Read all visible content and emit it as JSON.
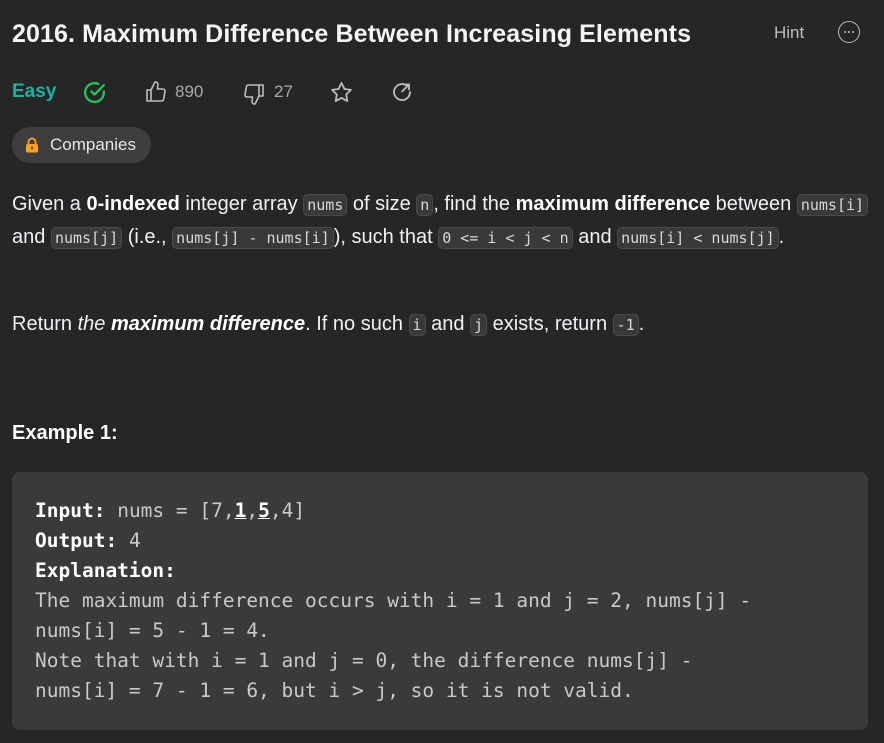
{
  "problem": {
    "title": "2016. Maximum Difference Between Increasing Elements",
    "hint_label": "Hint",
    "difficulty": "Easy",
    "likes": "890",
    "dislikes": "27",
    "companies_label": "Companies"
  },
  "description": {
    "p1": {
      "t1": "Given a ",
      "b1": "0-indexed",
      "t2": " integer array ",
      "c1": "nums",
      "t3": " of size ",
      "c2": "n",
      "t4": ", find the ",
      "b2": "maximum difference",
      "t5": " between ",
      "c3": "nums[i]",
      "t6": " and ",
      "c4": "nums[j]",
      "t7": " (i.e., ",
      "c5": "nums[j] - nums[i]",
      "t8": "), such that ",
      "c6": "0 <= i < j < n",
      "t9": " and ",
      "c7": "nums[i] < nums[j]",
      "t10": "."
    },
    "p2": {
      "t1": "Return ",
      "i1": "the ",
      "bi1": "maximum difference",
      "t2": ". If no such ",
      "c1": "i",
      "t3": " and ",
      "c2": "j",
      "t4": " exists, return ",
      "c3": "-1",
      "t5": "."
    }
  },
  "example": {
    "heading": "Example 1:",
    "input_label": "Input:",
    "input_prefix": "nums = [7,",
    "input_u1": "1",
    "input_sep": ",",
    "input_u2": "5",
    "input_suffix": ",4]",
    "output_label": "Output:",
    "output_value": "4",
    "explanation_label": "Explanation:",
    "lines": [
      "The maximum difference occurs with i = 1 and j = 2, nums[j] -",
      "nums[i] = 5 - 1 = 4.",
      "Note that with i = 1 and j = 0, the difference nums[j] -",
      "nums[i] = 7 - 1 = 6, but i > j, so it is not valid."
    ]
  },
  "colors": {
    "background": "#262626",
    "easy": "#16b3a4",
    "solved_check": "#22c55e",
    "lock": "#ffa116"
  },
  "icons": [
    "solved-check-icon",
    "thumbs-up-icon",
    "thumbs-down-icon",
    "star-icon",
    "share-icon",
    "lock-icon",
    "more-icon"
  ]
}
